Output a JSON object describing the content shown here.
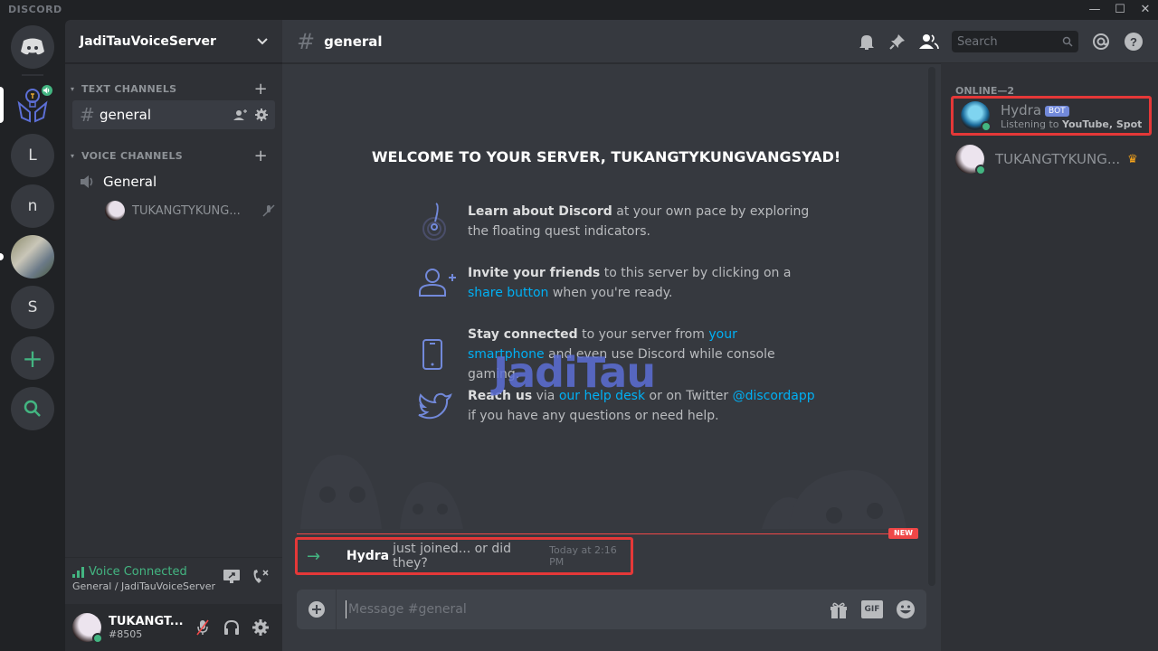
{
  "app": {
    "title": "DISCORD"
  },
  "window_controls": {
    "minimize": "—",
    "maximize": "☐",
    "close": "✕"
  },
  "guilds": {
    "items": [
      {
        "name": "home",
        "label": ""
      },
      {
        "name": "JadiTauVoiceServer",
        "label": ""
      },
      {
        "name": "L",
        "label": "L"
      },
      {
        "name": "n",
        "label": "n"
      },
      {
        "name": "photo-server",
        "label": ""
      },
      {
        "name": "S",
        "label": "S"
      },
      {
        "name": "add-server",
        "label": "+"
      },
      {
        "name": "explore",
        "label": ""
      }
    ]
  },
  "server": {
    "name": "JadiTauVoiceServer",
    "text_category": "TEXT CHANNELS",
    "voice_category": "VOICE CHANNELS",
    "text_channels": [
      {
        "name": "general"
      }
    ],
    "voice_channels": [
      {
        "name": "General",
        "users": [
          "TUKANGTYKUNG..."
        ]
      }
    ]
  },
  "voice_panel": {
    "status": "Voice Connected",
    "location": "General / JadiTauVoiceServer"
  },
  "user_panel": {
    "username": "TUKANGT...",
    "tag": "#8505"
  },
  "channel": {
    "name": "general"
  },
  "header": {
    "search_placeholder": "Search"
  },
  "welcome": {
    "title": "WELCOME TO YOUR SERVER, TUKANGTYKUNGVANGSYAD!",
    "tips": [
      {
        "bold": "Learn about Discord",
        "text1": " at your own pace by exploring the floating quest indicators.",
        "link": "",
        "text2": ""
      },
      {
        "bold": "Invite your friends",
        "text1": " to this server by clicking on a ",
        "link": "share button",
        "text2": " when you're ready."
      },
      {
        "bold": "Stay connected",
        "text1": " to your server from ",
        "link": "your smartphone",
        "text2": " and even use Discord while console gaming."
      },
      {
        "bold": "Reach us",
        "text1": " via ",
        "link": "our help desk",
        "text2": " or on Twitter ",
        "link2": "@discordapp",
        "text3": " if you have any questions or need help."
      }
    ]
  },
  "watermark": "JadiTau",
  "messages": {
    "new_badge": "NEW",
    "join": {
      "user": "Hydra",
      "text": "just joined... or did they?",
      "timestamp": "Today at 2:16 PM"
    }
  },
  "composer": {
    "placeholder": "Message #general",
    "gif_label": "GIF"
  },
  "members": {
    "header": "ONLINE—2",
    "list": [
      {
        "name": "Hydra",
        "badge": "BOT",
        "activity_prefix": "Listening to ",
        "activity": "YouTube, Spotify, ..."
      },
      {
        "name": "TUKANGTYKUNG...",
        "badge": "",
        "activity_prefix": "",
        "activity": ""
      }
    ]
  },
  "colors": {
    "accent": "#7289da",
    "online": "#43b581",
    "link": "#00b0f4",
    "highlight": "#e53838"
  }
}
